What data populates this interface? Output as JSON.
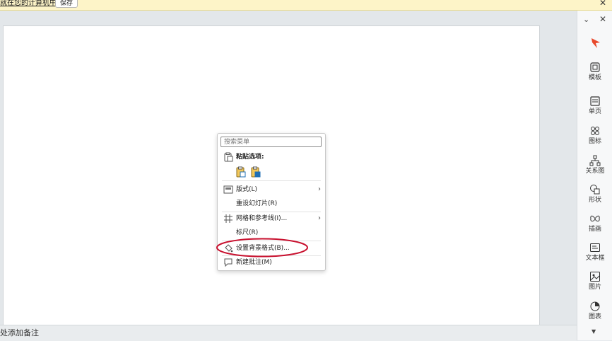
{
  "notification": {
    "text": "就在您的计算机中。",
    "save_button": "保存",
    "close_glyph": "✕"
  },
  "notes": {
    "placeholder": "处添加备注"
  },
  "right_panel": {
    "collapse_glyph": "⌄",
    "close_glyph": "✕",
    "items": [
      {
        "label": "模板",
        "icon": "template-icon"
      },
      {
        "label": "单页",
        "icon": "single-page-icon"
      },
      {
        "label": "图标",
        "icon": "icons-icon"
      },
      {
        "label": "关系图",
        "icon": "relationship-diagram-icon"
      },
      {
        "label": "形状",
        "icon": "shapes-icon"
      },
      {
        "label": "插画",
        "icon": "illustration-icon"
      },
      {
        "label": "文本框",
        "icon": "textbox-icon"
      },
      {
        "label": "图片",
        "icon": "picture-icon"
      },
      {
        "label": "图表",
        "icon": "chart-icon"
      }
    ],
    "more_glyph": "▼"
  },
  "context_menu": {
    "search_placeholder": "搜索菜单",
    "paste_options": "粘贴选项:",
    "layout": "版式(L)",
    "reset_slide": "重设幻灯片(R)",
    "grid_guides": "网格和参考线(I)...",
    "ruler": "标尺(R)",
    "format_background": "设置背景格式(B)...",
    "new_comment": "新建批注(M)",
    "submenu_arrow": "›"
  },
  "colors": {
    "annotation": "#c8102e",
    "accent": "#e8492c",
    "notice_bg": "#fdf4c8"
  }
}
